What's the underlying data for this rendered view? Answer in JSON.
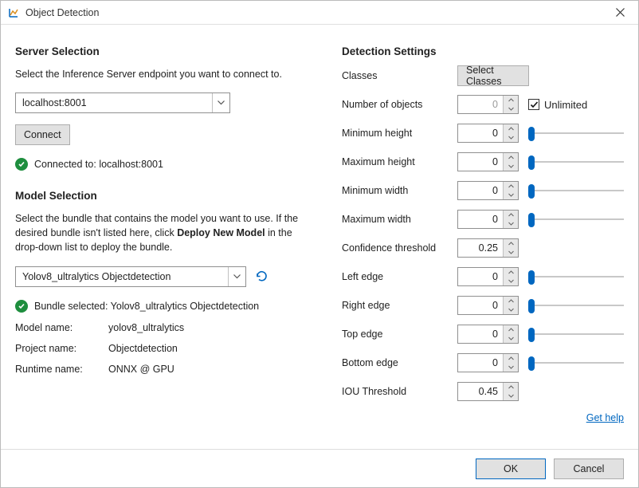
{
  "window": {
    "title": "Object Detection"
  },
  "left": {
    "server": {
      "heading": "Server Selection",
      "desc": "Select the Inference Server endpoint you want to connect to.",
      "combo_value": "localhost:8001",
      "connect_label": "Connect",
      "status_prefix": "Connected to: ",
      "status_value": "localhost:8001"
    },
    "model": {
      "heading": "Model Selection",
      "desc_a": "Select the bundle that contains the model you want to use. If the desired bundle isn't listed here, click ",
      "desc_bold": "Deploy New Model",
      "desc_b": " in the drop-down list to deploy the bundle.",
      "combo_value": "Yolov8_ultralytics Objectdetection",
      "status": "Bundle selected: Yolov8_ultralytics Objectdetection",
      "rows": {
        "model_name_k": "Model name:",
        "model_name_v": "yolov8_ultralytics",
        "project_k": "Project name:",
        "project_v": "Objectdetection",
        "runtime_k": "Runtime name:",
        "runtime_v": "ONNX @ GPU"
      }
    }
  },
  "right": {
    "heading": "Detection Settings",
    "classes_label": "Classes",
    "select_classes_label": "Select Classes",
    "rows": {
      "num_objects": {
        "label": "Number of objects",
        "value": "0",
        "disabled": true,
        "slider": false,
        "unlimited": true
      },
      "unlimited_label": "Unlimited",
      "min_height": {
        "label": "Minimum height",
        "value": "0",
        "slider": true
      },
      "max_height": {
        "label": "Maximum height",
        "value": "0",
        "slider": true
      },
      "min_width": {
        "label": "Minimum width",
        "value": "0",
        "slider": true
      },
      "max_width": {
        "label": "Maximum width",
        "value": "0",
        "slider": true
      },
      "conf": {
        "label": "Confidence threshold",
        "value": "0.25",
        "slider": false
      },
      "left_edge": {
        "label": "Left edge",
        "value": "0",
        "slider": true
      },
      "right_edge": {
        "label": "Right edge",
        "value": "0",
        "slider": true
      },
      "top_edge": {
        "label": "Top edge",
        "value": "0",
        "slider": true
      },
      "bottom_edge": {
        "label": "Bottom edge",
        "value": "0",
        "slider": true
      },
      "iou": {
        "label": "IOU Threshold",
        "value": "0.45",
        "slider": false
      }
    },
    "help_label": "Get help"
  },
  "footer": {
    "ok": "OK",
    "cancel": "Cancel"
  }
}
